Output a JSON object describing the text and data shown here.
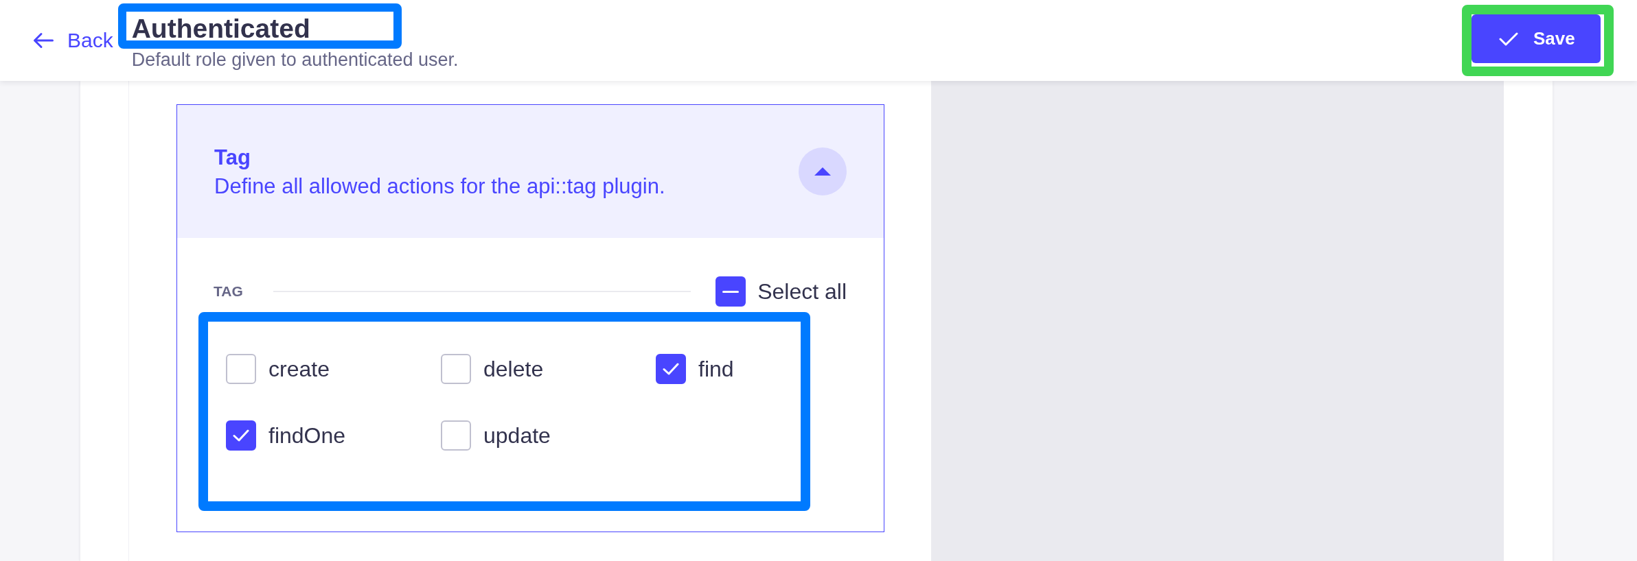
{
  "header": {
    "back_link": "Back",
    "title": "Authenticated",
    "subtitle": "Default role given to authenticated user.",
    "save_button": "Save"
  },
  "permissions": {
    "title": "Tag",
    "description": "Define all allowed actions for the api::tag plugin.",
    "expanded": true,
    "section_label": "TAG",
    "select_all": {
      "label": "Select all",
      "checked": false,
      "indeterminate": true
    },
    "actions": [
      {
        "label": "create",
        "checked": false
      },
      {
        "label": "delete",
        "checked": false
      },
      {
        "label": "find",
        "checked": true
      },
      {
        "label": "findOne",
        "checked": true
      },
      {
        "label": "update",
        "checked": false
      }
    ]
  },
  "highlights": {
    "title": {
      "color": "#007aff"
    },
    "actions": {
      "color": "#007aff"
    },
    "save_button": {
      "color": "#40d654"
    }
  }
}
